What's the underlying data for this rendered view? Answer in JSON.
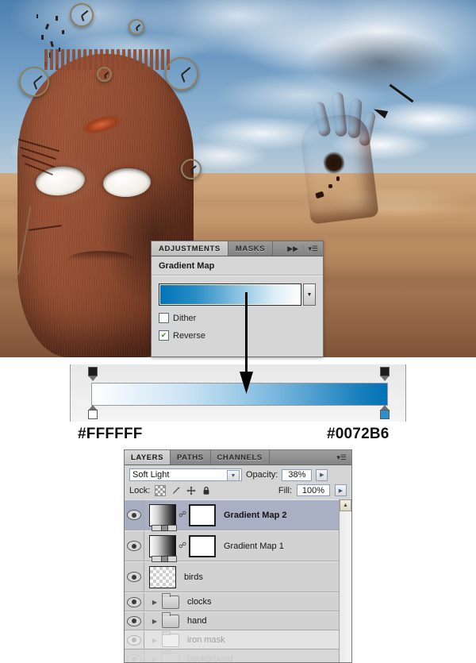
{
  "artwork": {
    "description": "Surreal desert photo montage: cracked iron mask head, emerging hand, flying clocks and birds under a cloudy sky"
  },
  "adjustments_panel": {
    "tabs": [
      {
        "label": "ADJUSTMENTS",
        "active": true
      },
      {
        "label": "MASKS",
        "active": false
      }
    ],
    "collapse_icon": "double-right-chevron-icon",
    "menu_icon": "panel-menu-icon",
    "title": "Gradient Map",
    "gradient_preview": {
      "from": "#0072B6",
      "to": "#FFFFFF",
      "dropdown_icon": "chevron-down-icon"
    },
    "options": [
      {
        "label": "Dither",
        "checked": false
      },
      {
        "label": "Reverse",
        "checked": true
      }
    ],
    "check_glyph": "✔"
  },
  "annotation": {
    "arrow": "down-arrow-pointer"
  },
  "gradient_editor": {
    "left_stop_color": "#FFFFFF",
    "right_stop_color": "#0072B6",
    "left_hex_label": "#FFFFFF",
    "right_hex_label": "#0072B6",
    "opacity_stop_icon": "opacity-stop-marker",
    "color_stop_icon": "color-stop-marker"
  },
  "layers_panel": {
    "tabs": [
      {
        "label": "LAYERS",
        "active": true
      },
      {
        "label": "PATHS",
        "active": false
      },
      {
        "label": "CHANNELS",
        "active": false
      }
    ],
    "menu_icon": "panel-menu-icon",
    "blend_mode": "Soft Light",
    "blend_caret_icon": "chevron-down-icon",
    "opacity_label": "Opacity:",
    "opacity_value": "38%",
    "opacity_stepper_icon": "stepper-arrow-icon",
    "lock_label": "Lock:",
    "lock_icons": [
      "lock-transparency-icon",
      "lock-image-pixels-brush-icon",
      "lock-position-move-icon",
      "lock-all-padlock-icon"
    ],
    "fill_label": "Fill:",
    "fill_value": "100%",
    "fill_stepper_icon": "stepper-arrow-icon",
    "scrollbar_up_icon": "scroll-up-arrow-icon",
    "layers": [
      {
        "name": "Gradient Map 2",
        "type": "adjustment",
        "selected": true,
        "visible": true,
        "dimmed": false,
        "has_mask": true,
        "link_icon": "mask-link-icon",
        "eye_icon": "eye-visibility-icon"
      },
      {
        "name": "Gradient Map 1",
        "type": "adjustment",
        "selected": false,
        "visible": true,
        "dimmed": false,
        "has_mask": true,
        "link_icon": "mask-link-icon",
        "eye_icon": "eye-visibility-icon"
      },
      {
        "name": "birds",
        "type": "pixel",
        "selected": false,
        "visible": true,
        "dimmed": false,
        "has_mask": false,
        "eye_icon": "eye-visibility-icon"
      },
      {
        "name": "clocks",
        "type": "group",
        "selected": false,
        "visible": true,
        "dimmed": false,
        "disclosure_icon": "disclosure-triangle-icon",
        "folder_icon": "folder-icon",
        "eye_icon": "eye-visibility-icon"
      },
      {
        "name": "hand",
        "type": "group",
        "selected": false,
        "visible": true,
        "dimmed": false,
        "disclosure_icon": "disclosure-triangle-icon",
        "folder_icon": "folder-icon",
        "eye_icon": "eye-visibility-icon"
      },
      {
        "name": "iron mask",
        "type": "group",
        "selected": false,
        "visible": true,
        "dimmed": true,
        "disclosure_icon": "disclosure-triangle-icon",
        "folder_icon": "folder-icon",
        "eye_icon": "eye-visibility-icon"
      },
      {
        "name": "background",
        "type": "group",
        "selected": false,
        "visible": true,
        "dimmed": true,
        "clipped": true,
        "disclosure_icon": "disclosure-triangle-icon",
        "folder_icon": "folder-icon",
        "eye_icon": "eye-visibility-icon"
      }
    ]
  }
}
